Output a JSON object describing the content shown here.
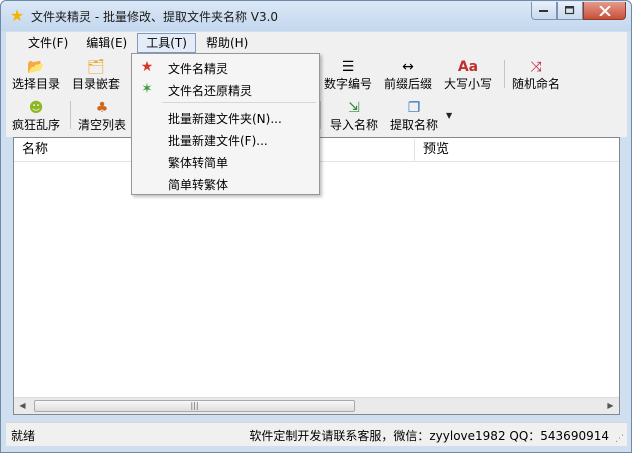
{
  "window": {
    "title": "文件夹精灵 - 批量修改、提取文件夹名称 V3.0",
    "icon": "star-icon"
  },
  "menubar": {
    "items": [
      {
        "label": "文件(F)"
      },
      {
        "label": "编辑(E)"
      },
      {
        "label": "工具(T)",
        "active": true
      },
      {
        "label": "帮助(H)"
      }
    ]
  },
  "toolbar": {
    "row1": [
      {
        "label": "选择目录",
        "icon": "folder-open-icon"
      },
      {
        "label": "目录嵌套",
        "icon": "folder-nested-icon"
      },
      {
        "label": "数字编号",
        "icon": "numbered-list-icon"
      },
      {
        "label": "前缀后缀",
        "icon": "double-arrow-icon"
      },
      {
        "label": "大写小写",
        "icon": "letter-case-icon"
      },
      {
        "label": "随机命名",
        "icon": "shuffle-icon"
      }
    ],
    "row2": [
      {
        "label": "疯狂乱序",
        "icon": "crazy-face-icon"
      },
      {
        "label": "清空列表",
        "icon": "broom-icon"
      },
      {
        "label": "导入名称",
        "icon": "import-icon"
      },
      {
        "label": "提取名称",
        "icon": "copy-extract-icon"
      }
    ]
  },
  "tools_menu": {
    "items": [
      {
        "label": "文件名精灵",
        "icon": "red-star-icon"
      },
      {
        "label": "文件名还原精灵",
        "icon": "color-star-icon"
      },
      {
        "label": "批量新建文件夹(N)..."
      },
      {
        "label": "批量新建文件(F)..."
      },
      {
        "label": "繁体转简单"
      },
      {
        "label": "简单转繁体"
      }
    ]
  },
  "list": {
    "columns": [
      "名称",
      "预览"
    ],
    "rows": []
  },
  "statusbar": {
    "left": "就绪",
    "right": "软件定制开发请联系客服，微信：zyylove1982  QQ：543690914"
  },
  "colors": {
    "title_bg": "#c3d7ee",
    "close_button": "#c8503a",
    "menu_active": "#e3ecf7"
  }
}
